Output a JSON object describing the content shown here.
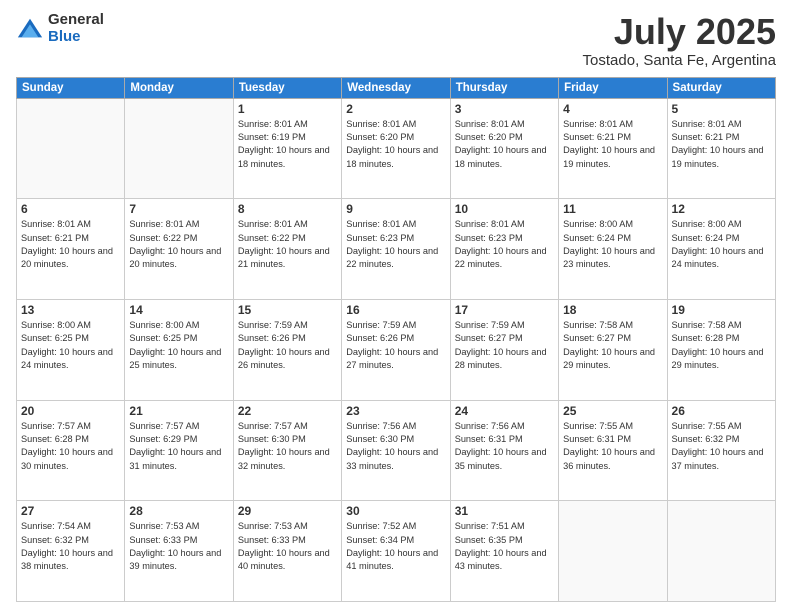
{
  "header": {
    "logo_general": "General",
    "logo_blue": "Blue",
    "title": "July 2025",
    "location": "Tostado, Santa Fe, Argentina"
  },
  "days_of_week": [
    "Sunday",
    "Monday",
    "Tuesday",
    "Wednesday",
    "Thursday",
    "Friday",
    "Saturday"
  ],
  "weeks": [
    [
      {
        "day": "",
        "info": ""
      },
      {
        "day": "",
        "info": ""
      },
      {
        "day": "1",
        "info": "Sunrise: 8:01 AM\nSunset: 6:19 PM\nDaylight: 10 hours and 18 minutes."
      },
      {
        "day": "2",
        "info": "Sunrise: 8:01 AM\nSunset: 6:20 PM\nDaylight: 10 hours and 18 minutes."
      },
      {
        "day": "3",
        "info": "Sunrise: 8:01 AM\nSunset: 6:20 PM\nDaylight: 10 hours and 18 minutes."
      },
      {
        "day": "4",
        "info": "Sunrise: 8:01 AM\nSunset: 6:21 PM\nDaylight: 10 hours and 19 minutes."
      },
      {
        "day": "5",
        "info": "Sunrise: 8:01 AM\nSunset: 6:21 PM\nDaylight: 10 hours and 19 minutes."
      }
    ],
    [
      {
        "day": "6",
        "info": "Sunrise: 8:01 AM\nSunset: 6:21 PM\nDaylight: 10 hours and 20 minutes."
      },
      {
        "day": "7",
        "info": "Sunrise: 8:01 AM\nSunset: 6:22 PM\nDaylight: 10 hours and 20 minutes."
      },
      {
        "day": "8",
        "info": "Sunrise: 8:01 AM\nSunset: 6:22 PM\nDaylight: 10 hours and 21 minutes."
      },
      {
        "day": "9",
        "info": "Sunrise: 8:01 AM\nSunset: 6:23 PM\nDaylight: 10 hours and 22 minutes."
      },
      {
        "day": "10",
        "info": "Sunrise: 8:01 AM\nSunset: 6:23 PM\nDaylight: 10 hours and 22 minutes."
      },
      {
        "day": "11",
        "info": "Sunrise: 8:00 AM\nSunset: 6:24 PM\nDaylight: 10 hours and 23 minutes."
      },
      {
        "day": "12",
        "info": "Sunrise: 8:00 AM\nSunset: 6:24 PM\nDaylight: 10 hours and 24 minutes."
      }
    ],
    [
      {
        "day": "13",
        "info": "Sunrise: 8:00 AM\nSunset: 6:25 PM\nDaylight: 10 hours and 24 minutes."
      },
      {
        "day": "14",
        "info": "Sunrise: 8:00 AM\nSunset: 6:25 PM\nDaylight: 10 hours and 25 minutes."
      },
      {
        "day": "15",
        "info": "Sunrise: 7:59 AM\nSunset: 6:26 PM\nDaylight: 10 hours and 26 minutes."
      },
      {
        "day": "16",
        "info": "Sunrise: 7:59 AM\nSunset: 6:26 PM\nDaylight: 10 hours and 27 minutes."
      },
      {
        "day": "17",
        "info": "Sunrise: 7:59 AM\nSunset: 6:27 PM\nDaylight: 10 hours and 28 minutes."
      },
      {
        "day": "18",
        "info": "Sunrise: 7:58 AM\nSunset: 6:27 PM\nDaylight: 10 hours and 29 minutes."
      },
      {
        "day": "19",
        "info": "Sunrise: 7:58 AM\nSunset: 6:28 PM\nDaylight: 10 hours and 29 minutes."
      }
    ],
    [
      {
        "day": "20",
        "info": "Sunrise: 7:57 AM\nSunset: 6:28 PM\nDaylight: 10 hours and 30 minutes."
      },
      {
        "day": "21",
        "info": "Sunrise: 7:57 AM\nSunset: 6:29 PM\nDaylight: 10 hours and 31 minutes."
      },
      {
        "day": "22",
        "info": "Sunrise: 7:57 AM\nSunset: 6:30 PM\nDaylight: 10 hours and 32 minutes."
      },
      {
        "day": "23",
        "info": "Sunrise: 7:56 AM\nSunset: 6:30 PM\nDaylight: 10 hours and 33 minutes."
      },
      {
        "day": "24",
        "info": "Sunrise: 7:56 AM\nSunset: 6:31 PM\nDaylight: 10 hours and 35 minutes."
      },
      {
        "day": "25",
        "info": "Sunrise: 7:55 AM\nSunset: 6:31 PM\nDaylight: 10 hours and 36 minutes."
      },
      {
        "day": "26",
        "info": "Sunrise: 7:55 AM\nSunset: 6:32 PM\nDaylight: 10 hours and 37 minutes."
      }
    ],
    [
      {
        "day": "27",
        "info": "Sunrise: 7:54 AM\nSunset: 6:32 PM\nDaylight: 10 hours and 38 minutes."
      },
      {
        "day": "28",
        "info": "Sunrise: 7:53 AM\nSunset: 6:33 PM\nDaylight: 10 hours and 39 minutes."
      },
      {
        "day": "29",
        "info": "Sunrise: 7:53 AM\nSunset: 6:33 PM\nDaylight: 10 hours and 40 minutes."
      },
      {
        "day": "30",
        "info": "Sunrise: 7:52 AM\nSunset: 6:34 PM\nDaylight: 10 hours and 41 minutes."
      },
      {
        "day": "31",
        "info": "Sunrise: 7:51 AM\nSunset: 6:35 PM\nDaylight: 10 hours and 43 minutes."
      },
      {
        "day": "",
        "info": ""
      },
      {
        "day": "",
        "info": ""
      }
    ]
  ]
}
